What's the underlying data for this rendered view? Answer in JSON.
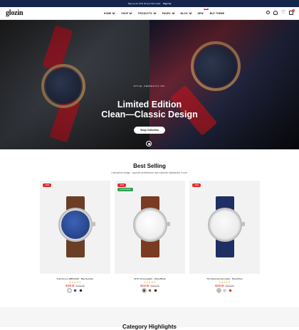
{
  "announcement": {
    "text": "Sign up for 10% off your first order.",
    "link": "Sign Up"
  },
  "brand": {
    "logo": "glozin"
  },
  "nav": {
    "items": [
      "HOME",
      "SHOP",
      "PRODUCTS",
      "PAGES",
      "BLOG",
      "NEW",
      "BUY THEME"
    ],
    "badge": "Hot",
    "cart_count": "0"
  },
  "hero": {
    "eyebrow": "STYLE, PERFECTLY ON.",
    "line1": "Limited Edition",
    "line2": "Clean—Classic Design",
    "cta": "Shop Collection"
  },
  "best_selling": {
    "title": "Best Selling",
    "subtitle": "Unmatched design - superior performance and customer satisfaction in one.",
    "products": [
      {
        "name": "FranTimers 1BB4X200 - Blue/Leather",
        "price": "$195.00",
        "old_price": "$240.00",
        "tag": "-15%",
        "tag2": "",
        "stars": "★★★★★",
        "swatches": [
          "#ffffff",
          "#2b3c8e",
          "#111111"
        ]
      },
      {
        "name": "NHO Chronograph - Silver/Black",
        "price": "$215.00",
        "old_price": "$260.00",
        "tag": "-20%",
        "tag2": "Limited Stock",
        "stars": "★★★★★",
        "swatches": [
          "#3a2a20",
          "#7a4a30",
          "#111111"
        ]
      },
      {
        "name": "The Maverick Automatic - Blue/Silver",
        "price": "$225.00",
        "old_price": "$270.00",
        "tag": "-15%",
        "tag2": "",
        "stars": "★★★★★",
        "swatches": [
          "#caa47a",
          "#c9c9c9",
          "#e02b2b"
        ]
      }
    ]
  },
  "category": {
    "title": "Category Highlights"
  },
  "colors": {
    "accent": "#e02b2b",
    "topbar": "#15244a",
    "sale": "#e02b2b",
    "stock": "#2e9e4f"
  }
}
